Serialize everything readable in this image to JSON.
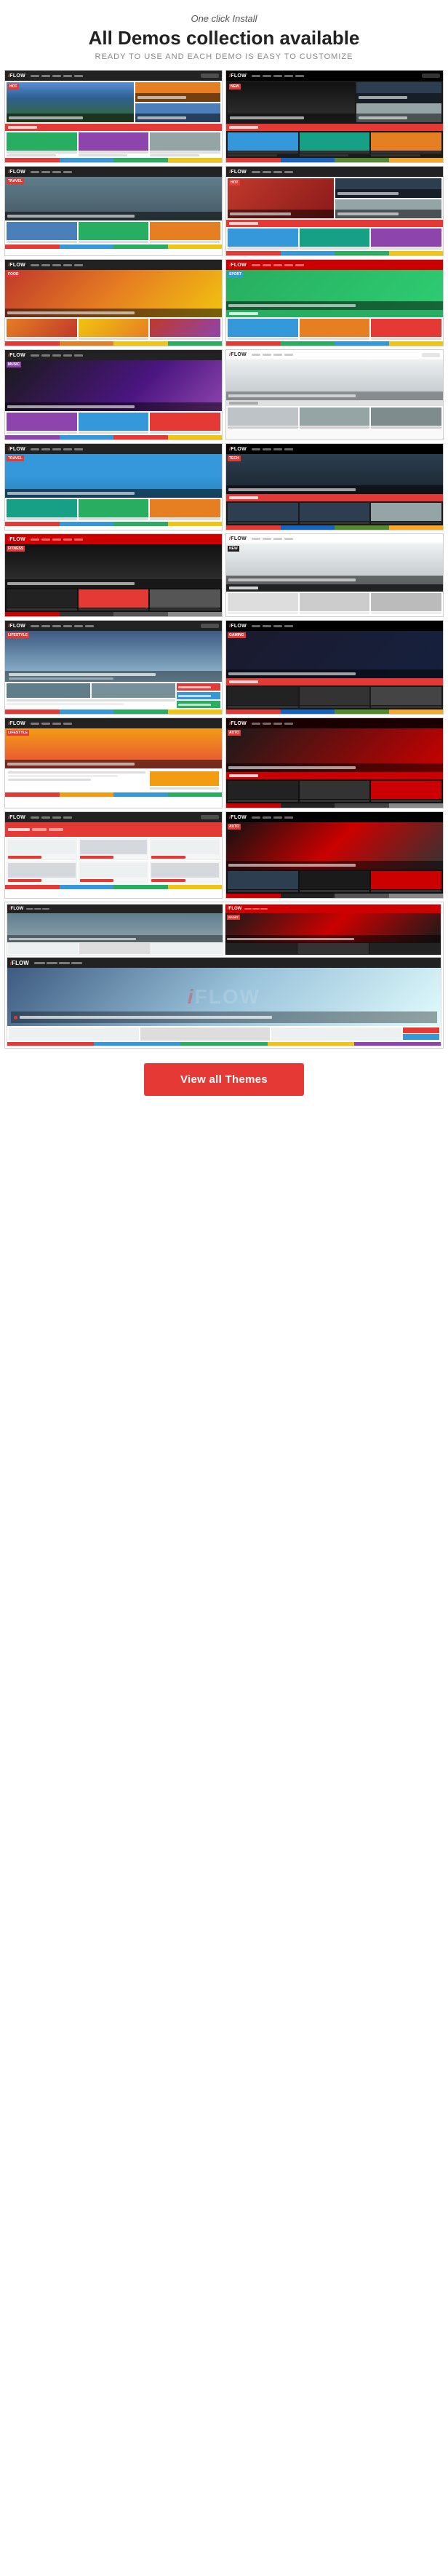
{
  "header": {
    "one_click": "One click Install",
    "main_title": "All Demos collection available",
    "subtitle": "READY TO USE AND EACH DEMO IS EASY TO CUSTOMIZE"
  },
  "button": {
    "label": "View all Themes"
  },
  "demos": [
    {
      "id": 1,
      "theme": "light",
      "style": "magazine-dual",
      "row": 1
    },
    {
      "id": 2,
      "theme": "dark",
      "style": "magazine-dual",
      "row": 1
    },
    {
      "id": 3,
      "theme": "light",
      "style": "magazine-dual",
      "row": 2
    },
    {
      "id": 4,
      "theme": "dark",
      "style": "magazine-side",
      "row": 2
    },
    {
      "id": 5,
      "theme": "food",
      "style": "full-width",
      "row": 3
    },
    {
      "id": 6,
      "theme": "sports",
      "style": "magazine-dual",
      "row": 3
    },
    {
      "id": 7,
      "theme": "music",
      "style": "full-width",
      "row": 4
    },
    {
      "id": 8,
      "theme": "minimal",
      "style": "magazine-side",
      "row": 4
    },
    {
      "id": 9,
      "theme": "travel",
      "style": "magazine-dual",
      "row": 5
    },
    {
      "id": 10,
      "theme": "dark",
      "style": "magazine-dual",
      "row": 5
    },
    {
      "id": 11,
      "theme": "fitness",
      "style": "magazine-dual",
      "row": 6
    },
    {
      "id": 12,
      "theme": "fashion",
      "style": "magazine-dual",
      "row": 6
    },
    {
      "id": 13,
      "theme": "light",
      "style": "full-width",
      "row": 7
    },
    {
      "id": 14,
      "theme": "dark-tech",
      "style": "magazine-dual",
      "row": 7
    },
    {
      "id": 15,
      "theme": "light-alt",
      "style": "magazine-dual",
      "row": 8
    },
    {
      "id": 16,
      "theme": "dark-red",
      "style": "magazine-dual",
      "row": 8
    },
    {
      "id": 17,
      "theme": "ecommerce",
      "style": "shop",
      "row": 9
    },
    {
      "id": 18,
      "theme": "automotive",
      "style": "magazine-dual",
      "row": 9
    },
    {
      "id": 19,
      "theme": "light-multi",
      "style": "full-magazine",
      "row": 10
    }
  ]
}
